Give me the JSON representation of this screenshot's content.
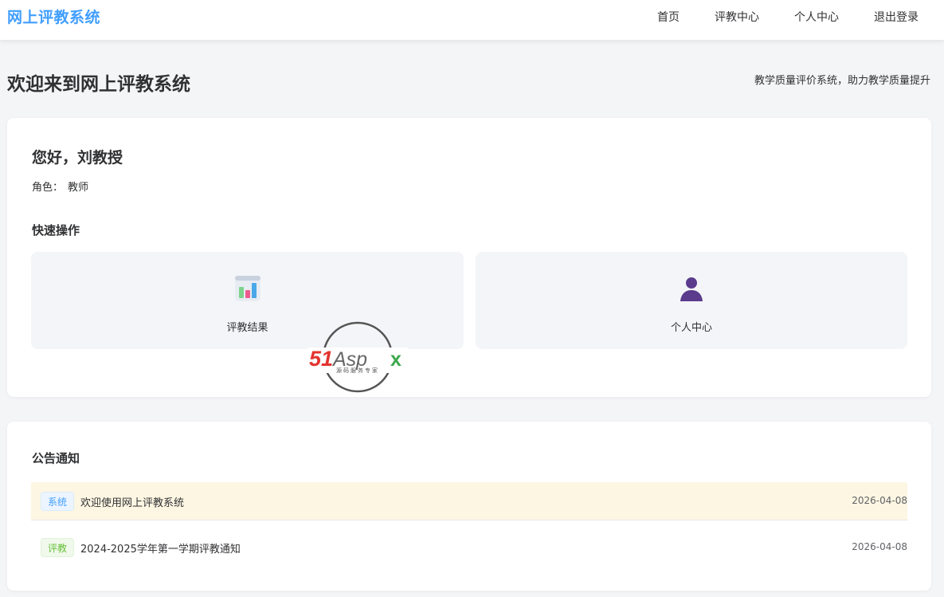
{
  "header": {
    "brand": "网上评教系统",
    "nav": [
      {
        "label": "首页"
      },
      {
        "label": "评教中心"
      },
      {
        "label": "个人中心"
      },
      {
        "label": "退出登录"
      }
    ]
  },
  "welcome": {
    "title": "欢迎来到网上评教系统",
    "subtitle": "教学质量评价系统，助力教学质量提升"
  },
  "user": {
    "greeting": "您好，刘教授",
    "role_label": "角色：",
    "role_value": "教师"
  },
  "quick_actions": {
    "title": "快速操作",
    "items": [
      {
        "label": "评教结果",
        "icon": "bar-chart-icon"
      },
      {
        "label": "个人中心",
        "icon": "user-icon"
      }
    ]
  },
  "notices": {
    "title": "公告通知",
    "items": [
      {
        "tag": "系统",
        "text": "欢迎使用网上评教系统",
        "date": "2026-04-08"
      },
      {
        "tag": "评教",
        "text": "2024-2025学年第一学期评教通知",
        "date": "2026-04-08"
      }
    ]
  },
  "watermark": {
    "brand": "51Aspx",
    "tagline": "源码服务专家"
  },
  "colors": {
    "accent": "#409eff",
    "highlight_row": "#fdf6e3",
    "tag_system": "#409eff",
    "tag_eval": "#67c23a"
  }
}
